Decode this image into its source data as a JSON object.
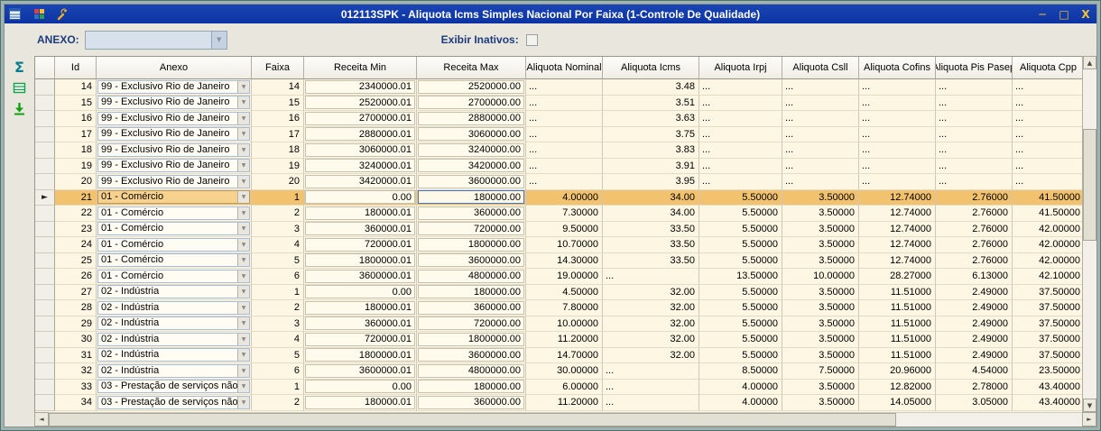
{
  "window": {
    "title": "012113SPK - Aliquota Icms Simples Nacional Por Faixa (1-Controle De Qualidade)",
    "minimize_glyph": "─",
    "maximize_glyph": "□",
    "close_glyph": "X"
  },
  "toolbar": {
    "anexo_label": "ANEXO:",
    "anexo_value": "",
    "exibir_label": "Exibir Inativos:",
    "exibir_checked": false
  },
  "side_toolbar": {
    "sum_glyph": "Σ"
  },
  "icons": {
    "dropdown_arrow": "▼",
    "scroll_up": "▲",
    "scroll_down": "▼",
    "scroll_left": "◄",
    "scroll_right": "►",
    "row_pointer": "►"
  },
  "colors": {
    "titlebar": "#0c33a2",
    "titlebar_text": "#ffffff",
    "window_chrome": "#e9e6de",
    "frame": "#9fb4b0",
    "label": "#1c3c7c",
    "grid_bg": "#fcf6e3",
    "header_bg": "#efede4",
    "selected_row": "#f2c26e",
    "focus_border": "#4472c4",
    "combo_border": "#a8bcd8",
    "scroll_face": "#e2dfd3",
    "sigma": "#0a7e8c"
  },
  "grid": {
    "selected_row_id": "21",
    "focused_cell": {
      "row_id": "21",
      "column": "receita_max"
    },
    "columns": [
      {
        "key": "id",
        "label": "Id"
      },
      {
        "key": "anexo",
        "label": "Anexo"
      },
      {
        "key": "faixa",
        "label": "Faixa"
      },
      {
        "key": "receita_min",
        "label": "Receita Min"
      },
      {
        "key": "receita_max",
        "label": "Receita Max"
      },
      {
        "key": "aliquota_nominal",
        "label": "Aliquota Nominal"
      },
      {
        "key": "aliquota_icms",
        "label": "Aliquota Icms"
      },
      {
        "key": "aliquota_irpj",
        "label": "Aliquota Irpj"
      },
      {
        "key": "aliquota_csll",
        "label": "Aliquota Csll"
      },
      {
        "key": "aliquota_cofins",
        "label": "Aliquota Cofins"
      },
      {
        "key": "aliquota_pis_pasep",
        "label": "Aliquota Pis Pasep"
      },
      {
        "key": "aliquota_cpp",
        "label": "Aliquota Cpp"
      }
    ],
    "rows": [
      {
        "id": "14",
        "anexo": "99 - Exclusivo Rio de Janeiro",
        "faixa": "14",
        "receita_min": "2340000.01",
        "receita_max": "2520000.00",
        "aliquota_nominal": "...",
        "aliquota_icms": "3.48",
        "aliquota_irpj": "...",
        "aliquota_csll": "...",
        "aliquota_cofins": "...",
        "aliquota_pis_pasep": "...",
        "aliquota_cpp": "..."
      },
      {
        "id": "15",
        "anexo": "99 - Exclusivo Rio de Janeiro",
        "faixa": "15",
        "receita_min": "2520000.01",
        "receita_max": "2700000.00",
        "aliquota_nominal": "...",
        "aliquota_icms": "3.51",
        "aliquota_irpj": "...",
        "aliquota_csll": "...",
        "aliquota_cofins": "...",
        "aliquota_pis_pasep": "...",
        "aliquota_cpp": "..."
      },
      {
        "id": "16",
        "anexo": "99 - Exclusivo Rio de Janeiro",
        "faixa": "16",
        "receita_min": "2700000.01",
        "receita_max": "2880000.00",
        "aliquota_nominal": "...",
        "aliquota_icms": "3.63",
        "aliquota_irpj": "...",
        "aliquota_csll": "...",
        "aliquota_cofins": "...",
        "aliquota_pis_pasep": "...",
        "aliquota_cpp": "..."
      },
      {
        "id": "17",
        "anexo": "99 - Exclusivo Rio de Janeiro",
        "faixa": "17",
        "receita_min": "2880000.01",
        "receita_max": "3060000.00",
        "aliquota_nominal": "...",
        "aliquota_icms": "3.75",
        "aliquota_irpj": "...",
        "aliquota_csll": "...",
        "aliquota_cofins": "...",
        "aliquota_pis_pasep": "...",
        "aliquota_cpp": "..."
      },
      {
        "id": "18",
        "anexo": "99 - Exclusivo Rio de Janeiro",
        "faixa": "18",
        "receita_min": "3060000.01",
        "receita_max": "3240000.00",
        "aliquota_nominal": "...",
        "aliquota_icms": "3.83",
        "aliquota_irpj": "...",
        "aliquota_csll": "...",
        "aliquota_cofins": "...",
        "aliquota_pis_pasep": "...",
        "aliquota_cpp": "..."
      },
      {
        "id": "19",
        "anexo": "99 - Exclusivo Rio de Janeiro",
        "faixa": "19",
        "receita_min": "3240000.01",
        "receita_max": "3420000.00",
        "aliquota_nominal": "...",
        "aliquota_icms": "3.91",
        "aliquota_irpj": "...",
        "aliquota_csll": "...",
        "aliquota_cofins": "...",
        "aliquota_pis_pasep": "...",
        "aliquota_cpp": "..."
      },
      {
        "id": "20",
        "anexo": "99 - Exclusivo Rio de Janeiro",
        "faixa": "20",
        "receita_min": "3420000.01",
        "receita_max": "3600000.00",
        "aliquota_nominal": "...",
        "aliquota_icms": "3.95",
        "aliquota_irpj": "...",
        "aliquota_csll": "...",
        "aliquota_cofins": "...",
        "aliquota_pis_pasep": "...",
        "aliquota_cpp": "..."
      },
      {
        "id": "21",
        "anexo": "01 - Comércio",
        "faixa": "1",
        "receita_min": "0.00",
        "receita_max": "180000.00",
        "aliquota_nominal": "4.00000",
        "aliquota_icms": "34.00",
        "aliquota_irpj": "5.50000",
        "aliquota_csll": "3.50000",
        "aliquota_cofins": "12.74000",
        "aliquota_pis_pasep": "2.76000",
        "aliquota_cpp": "41.50000"
      },
      {
        "id": "22",
        "anexo": "01 - Comércio",
        "faixa": "2",
        "receita_min": "180000.01",
        "receita_max": "360000.00",
        "aliquota_nominal": "7.30000",
        "aliquota_icms": "34.00",
        "aliquota_irpj": "5.50000",
        "aliquota_csll": "3.50000",
        "aliquota_cofins": "12.74000",
        "aliquota_pis_pasep": "2.76000",
        "aliquota_cpp": "41.50000"
      },
      {
        "id": "23",
        "anexo": "01 - Comércio",
        "faixa": "3",
        "receita_min": "360000.01",
        "receita_max": "720000.00",
        "aliquota_nominal": "9.50000",
        "aliquota_icms": "33.50",
        "aliquota_irpj": "5.50000",
        "aliquota_csll": "3.50000",
        "aliquota_cofins": "12.74000",
        "aliquota_pis_pasep": "2.76000",
        "aliquota_cpp": "42.00000"
      },
      {
        "id": "24",
        "anexo": "01 - Comércio",
        "faixa": "4",
        "receita_min": "720000.01",
        "receita_max": "1800000.00",
        "aliquota_nominal": "10.70000",
        "aliquota_icms": "33.50",
        "aliquota_irpj": "5.50000",
        "aliquota_csll": "3.50000",
        "aliquota_cofins": "12.74000",
        "aliquota_pis_pasep": "2.76000",
        "aliquota_cpp": "42.00000"
      },
      {
        "id": "25",
        "anexo": "01 - Comércio",
        "faixa": "5",
        "receita_min": "1800000.01",
        "receita_max": "3600000.00",
        "aliquota_nominal": "14.30000",
        "aliquota_icms": "33.50",
        "aliquota_irpj": "5.50000",
        "aliquota_csll": "3.50000",
        "aliquota_cofins": "12.74000",
        "aliquota_pis_pasep": "2.76000",
        "aliquota_cpp": "42.00000"
      },
      {
        "id": "26",
        "anexo": "01 - Comércio",
        "faixa": "6",
        "receita_min": "3600000.01",
        "receita_max": "4800000.00",
        "aliquota_nominal": "19.00000",
        "aliquota_icms": "...",
        "aliquota_irpj": "13.50000",
        "aliquota_csll": "10.00000",
        "aliquota_cofins": "28.27000",
        "aliquota_pis_pasep": "6.13000",
        "aliquota_cpp": "42.10000"
      },
      {
        "id": "27",
        "anexo": "02 - Indústria",
        "faixa": "1",
        "receita_min": "0.00",
        "receita_max": "180000.00",
        "aliquota_nominal": "4.50000",
        "aliquota_icms": "32.00",
        "aliquota_irpj": "5.50000",
        "aliquota_csll": "3.50000",
        "aliquota_cofins": "11.51000",
        "aliquota_pis_pasep": "2.49000",
        "aliquota_cpp": "37.50000"
      },
      {
        "id": "28",
        "anexo": "02 - Indústria",
        "faixa": "2",
        "receita_min": "180000.01",
        "receita_max": "360000.00",
        "aliquota_nominal": "7.80000",
        "aliquota_icms": "32.00",
        "aliquota_irpj": "5.50000",
        "aliquota_csll": "3.50000",
        "aliquota_cofins": "11.51000",
        "aliquota_pis_pasep": "2.49000",
        "aliquota_cpp": "37.50000"
      },
      {
        "id": "29",
        "anexo": "02 - Indústria",
        "faixa": "3",
        "receita_min": "360000.01",
        "receita_max": "720000.00",
        "aliquota_nominal": "10.00000",
        "aliquota_icms": "32.00",
        "aliquota_irpj": "5.50000",
        "aliquota_csll": "3.50000",
        "aliquota_cofins": "11.51000",
        "aliquota_pis_pasep": "2.49000",
        "aliquota_cpp": "37.50000"
      },
      {
        "id": "30",
        "anexo": "02 - Indústria",
        "faixa": "4",
        "receita_min": "720000.01",
        "receita_max": "1800000.00",
        "aliquota_nominal": "11.20000",
        "aliquota_icms": "32.00",
        "aliquota_irpj": "5.50000",
        "aliquota_csll": "3.50000",
        "aliquota_cofins": "11.51000",
        "aliquota_pis_pasep": "2.49000",
        "aliquota_cpp": "37.50000"
      },
      {
        "id": "31",
        "anexo": "02 - Indústria",
        "faixa": "5",
        "receita_min": "1800000.01",
        "receita_max": "3600000.00",
        "aliquota_nominal": "14.70000",
        "aliquota_icms": "32.00",
        "aliquota_irpj": "5.50000",
        "aliquota_csll": "3.50000",
        "aliquota_cofins": "11.51000",
        "aliquota_pis_pasep": "2.49000",
        "aliquota_cpp": "37.50000"
      },
      {
        "id": "32",
        "anexo": "02 - Indústria",
        "faixa": "6",
        "receita_min": "3600000.01",
        "receita_max": "4800000.00",
        "aliquota_nominal": "30.00000",
        "aliquota_icms": "...",
        "aliquota_irpj": "8.50000",
        "aliquota_csll": "7.50000",
        "aliquota_cofins": "20.96000",
        "aliquota_pis_pasep": "4.54000",
        "aliquota_cpp": "23.50000"
      },
      {
        "id": "33",
        "anexo": "03 - Prestação de serviços não",
        "faixa": "1",
        "receita_min": "0.00",
        "receita_max": "180000.00",
        "aliquota_nominal": "6.00000",
        "aliquota_icms": "...",
        "aliquota_irpj": "4.00000",
        "aliquota_csll": "3.50000",
        "aliquota_cofins": "12.82000",
        "aliquota_pis_pasep": "2.78000",
        "aliquota_cpp": "43.40000"
      },
      {
        "id": "34",
        "anexo": "03 - Prestação de serviços não",
        "faixa": "2",
        "receita_min": "180000.01",
        "receita_max": "360000.00",
        "aliquota_nominal": "11.20000",
        "aliquota_icms": "...",
        "aliquota_irpj": "4.00000",
        "aliquota_csll": "3.50000",
        "aliquota_cofins": "14.05000",
        "aliquota_pis_pasep": "3.05000",
        "aliquota_cpp": "43.40000"
      }
    ]
  }
}
